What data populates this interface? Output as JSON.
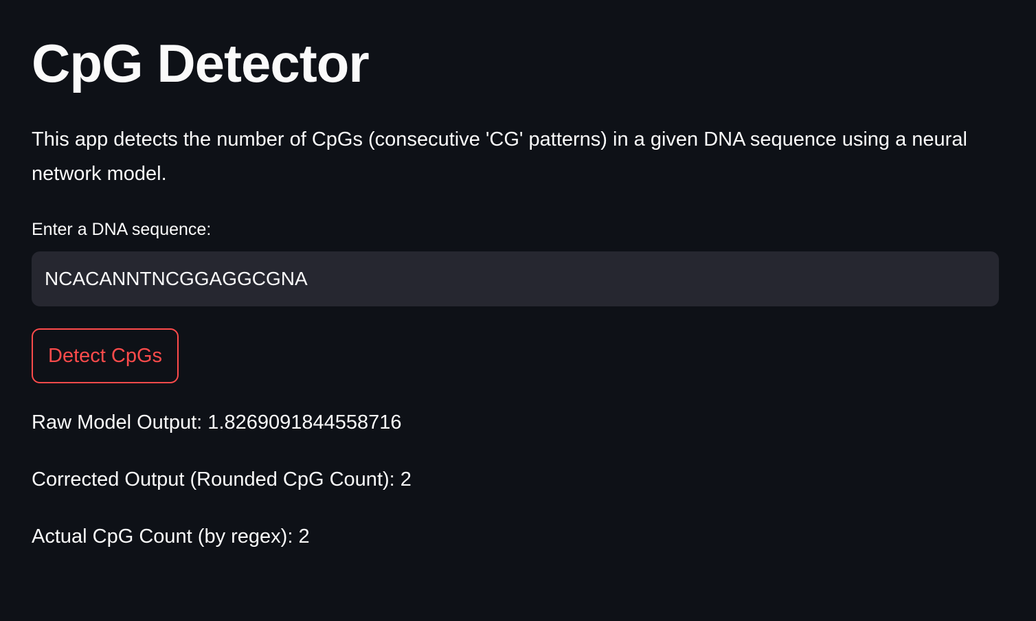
{
  "page": {
    "title": "CpG Detector",
    "description": "This app detects the number of CpGs (consecutive 'CG' patterns) in a given DNA sequence using a neural network model."
  },
  "form": {
    "input_label": "Enter a DNA sequence:",
    "input_value": "NCACANNTNCGGAGGCGNA",
    "button_label": "Detect CpGs"
  },
  "results": {
    "raw_output": "Raw Model Output: 1.8269091844558716",
    "corrected_output": "Corrected Output (Rounded CpG Count): 2",
    "actual_count": "Actual CpG Count (by regex): 2"
  },
  "colors": {
    "background": "#0e1117",
    "input_background": "#262730",
    "text": "#fafafa",
    "accent": "#ff4b4b"
  }
}
